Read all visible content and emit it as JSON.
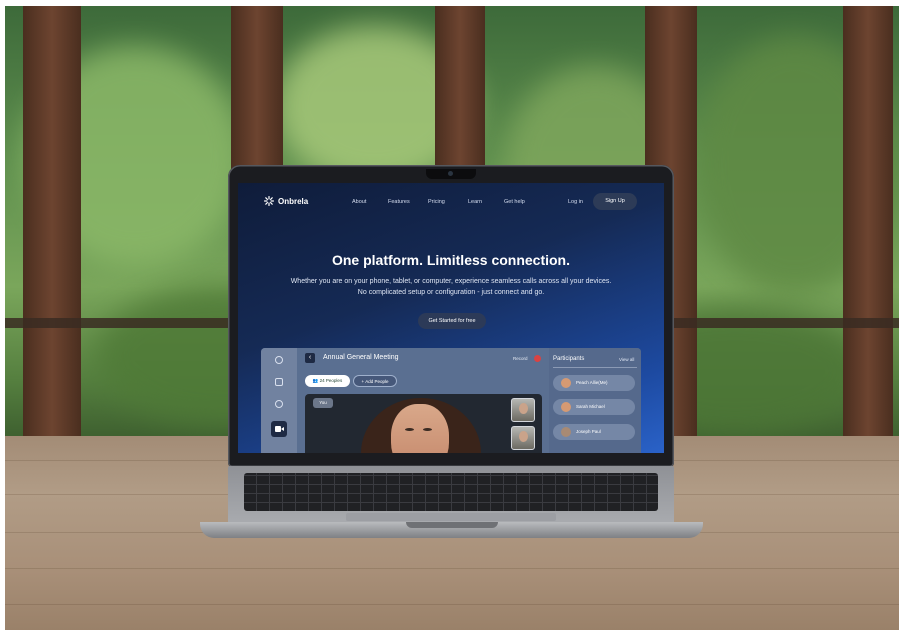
{
  "site": {
    "brand": "Onbrela",
    "nav_links": [
      "About",
      "Features",
      "Pricing",
      "Learn",
      "Get help"
    ],
    "login": "Log in",
    "signup": "Sign Up"
  },
  "hero": {
    "title": "One platform. Limitless connection.",
    "subtitle_line1": "Whether you are on your phone, tablet, or computer, experience seamless calls across all your devices.",
    "subtitle_line2": "No complicated setup or configuration - just connect and go.",
    "cta": "Get Started for free"
  },
  "meeting": {
    "title": "Annual General Meeting",
    "record": "Record",
    "people_count": "24 Peoples",
    "add_people": "Add People",
    "you_label": "You",
    "participants_title": "Participants",
    "view_all": "View all",
    "participants": [
      "Peach Allie(Me)",
      "Sarah Michael",
      "Joseph Paul"
    ]
  },
  "colors": {
    "hero_gradient_start": "#0f1c3a",
    "hero_gradient_end": "#2a62c8",
    "record_dot": "#d94343"
  }
}
